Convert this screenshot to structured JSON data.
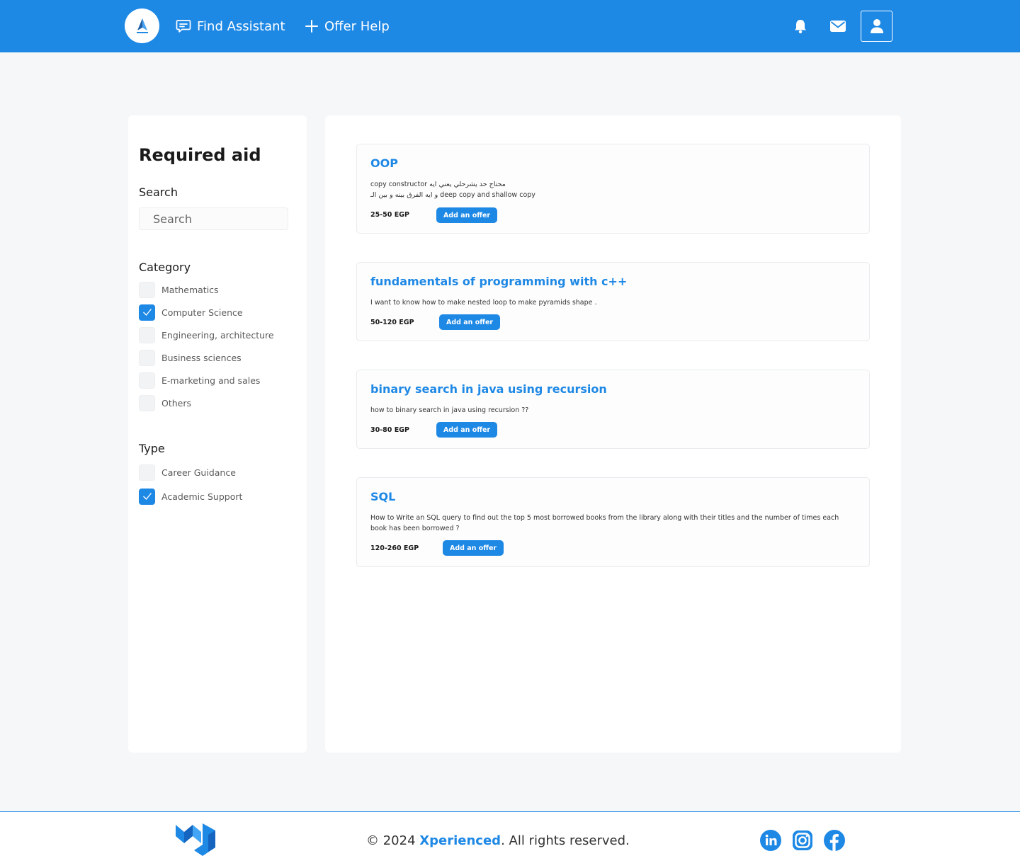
{
  "nav": {
    "find_assistant": "Find Assistant",
    "offer_help": "Offer Help"
  },
  "sidebar": {
    "title": "Required aid",
    "search_label": "Search",
    "search_placeholder": "Search",
    "category_label": "Category",
    "categories": [
      {
        "label": "Mathematics",
        "checked": false
      },
      {
        "label": "Computer Science",
        "checked": true
      },
      {
        "label": "Engineering, architecture",
        "checked": false
      },
      {
        "label": "Business sciences",
        "checked": false
      },
      {
        "label": "E-marketing and sales",
        "checked": false
      },
      {
        "label": "Others",
        "checked": false
      }
    ],
    "type_label": "Type",
    "types": [
      {
        "label": "Career Guidance",
        "checked": false
      },
      {
        "label": "Academic Support",
        "checked": true
      }
    ]
  },
  "requests": [
    {
      "title": "OOP",
      "desc_lines": [
        "copy constructor  محتاج حد يشرحلي  يعني ايه",
        "و ايه الفرق بينه و بين الـ deep copy and shallow copy"
      ],
      "price": "25-50 EGP",
      "button": "Add an offer"
    },
    {
      "title": "fundamentals of programming with c++",
      "desc_lines": [
        "I want to know how to make nested loop to make pyramids shape ."
      ],
      "price": "50-120 EGP",
      "button": "Add an offer"
    },
    {
      "title": "binary search in java using recursion",
      "desc_lines": [
        "how to binary search in java using recursion ??"
      ],
      "price": "30-80 EGP",
      "button": "Add an offer"
    },
    {
      "title": "SQL",
      "desc_lines": [
        "How to Write an SQL query to find out the top 5 most borrowed books from the library along with their titles and the number of times each",
        "book has been borrowed ?"
      ],
      "price": "120-260 EGP",
      "button": "Add an offer"
    }
  ],
  "footer": {
    "copyright_prefix": "© 2024 ",
    "brand": "Xperienced",
    "copyright_suffix": ". All rights reserved."
  },
  "colors": {
    "primary": "#1e88e5",
    "background": "#f6f7f8"
  },
  "icons": {
    "find_assistant": "chat-icon",
    "offer_help": "plus-icon",
    "notifications": "bell-icon",
    "messages": "mail-icon",
    "profile": "user-icon",
    "social": [
      "linkedin-icon",
      "instagram-icon",
      "facebook-icon"
    ]
  }
}
